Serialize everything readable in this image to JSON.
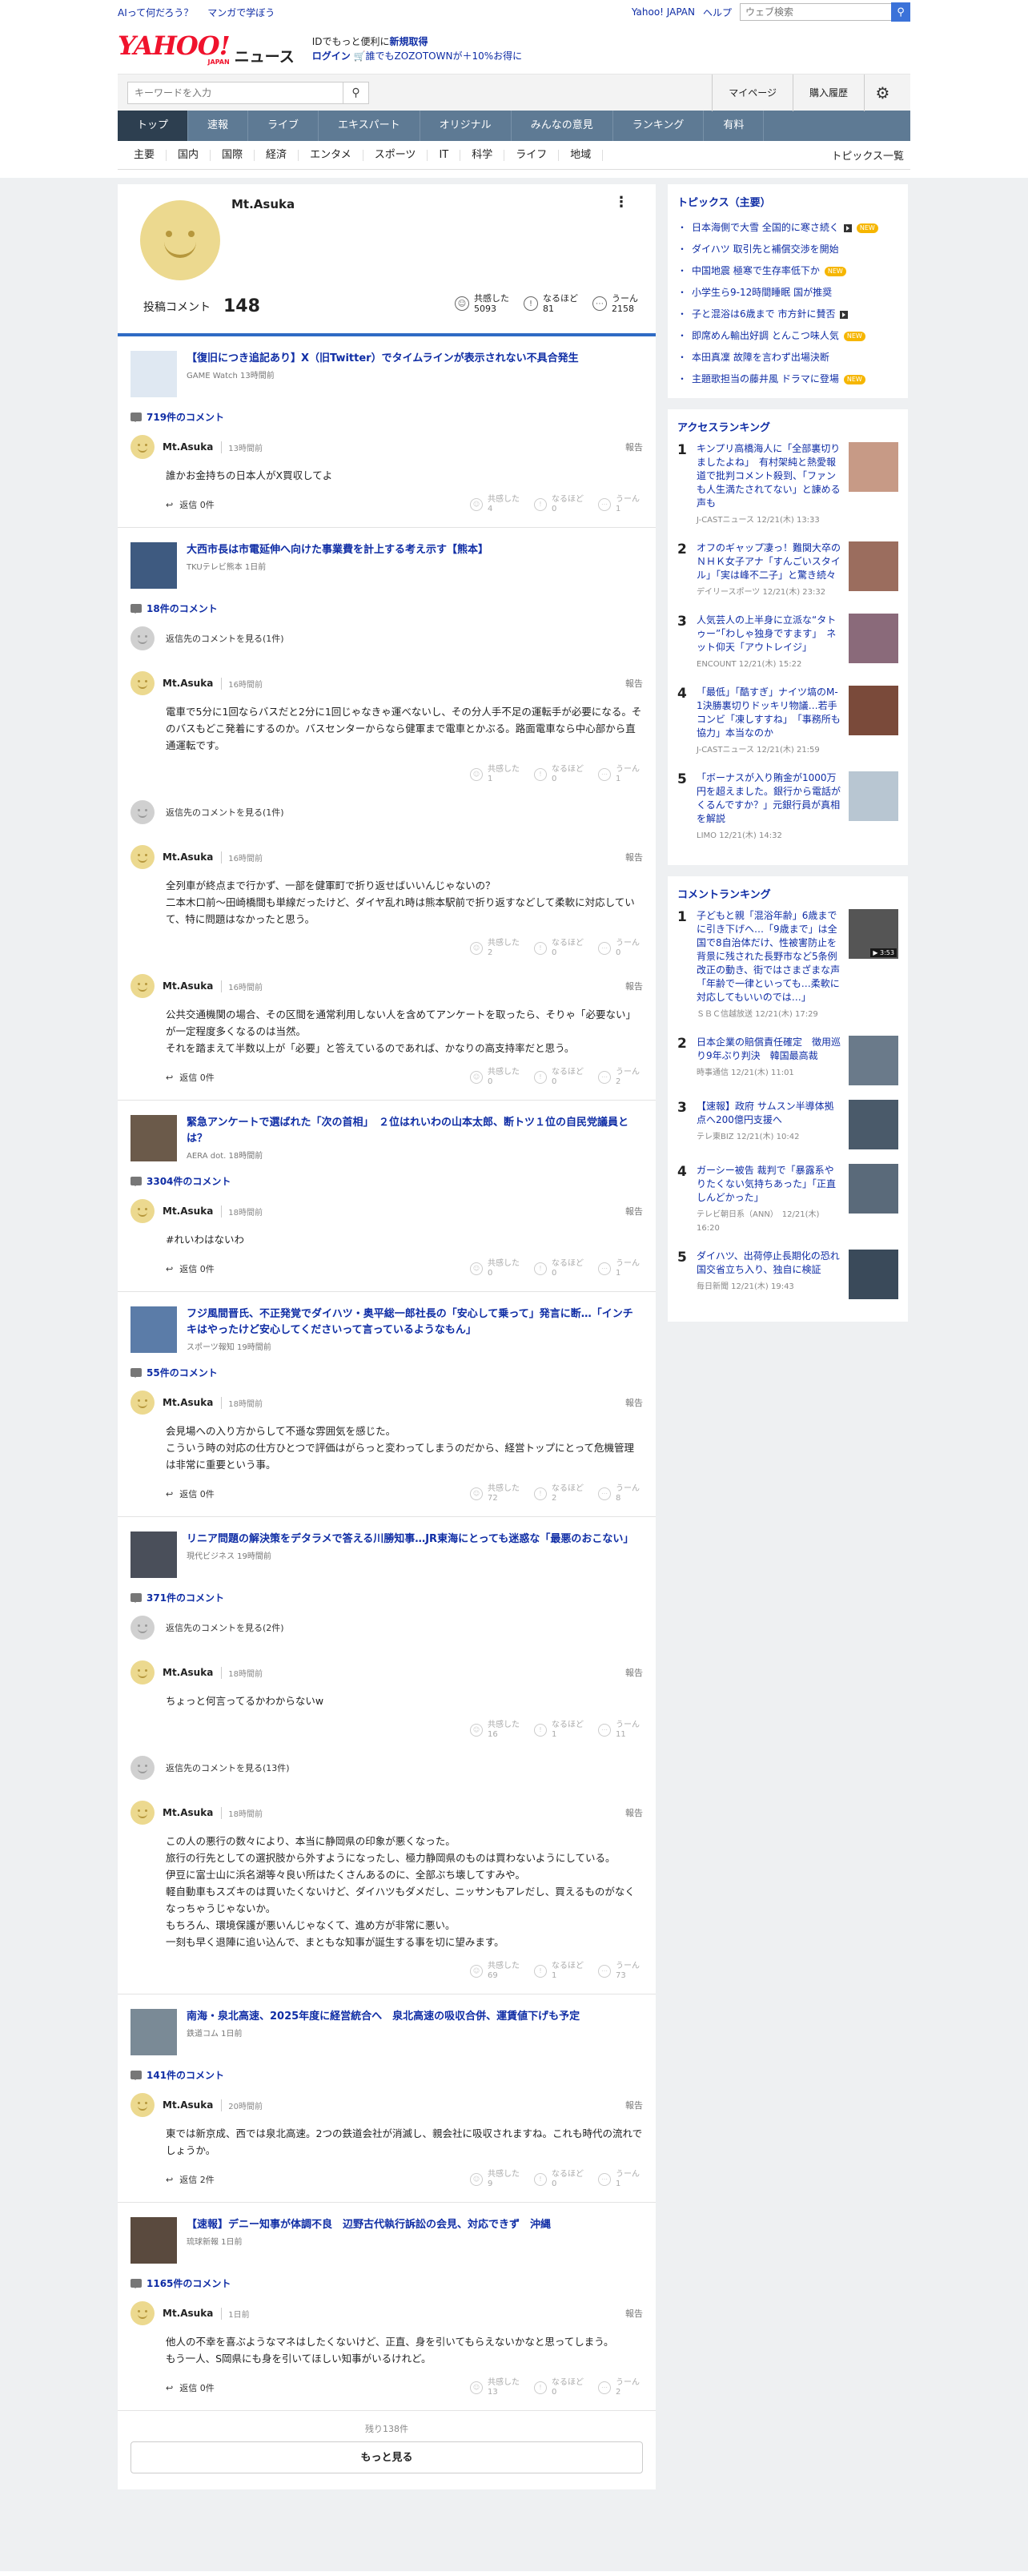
{
  "util": {
    "left": [
      "AIって何だろう？",
      "マンガで学ぼう"
    ],
    "right": [
      "Yahoo! JAPAN",
      "ヘルプ"
    ],
    "search_placeholder": "ウェブ検索"
  },
  "header": {
    "logo": "YAHOO!",
    "logo_sub": "JAPAN",
    "section": "ニュース",
    "promo1_a": "IDでもっと便利に",
    "promo1_b": "新規取得",
    "promo2_a": "ログイン",
    "promo2_b": "誰でもZOZOTOWNが＋10%お得に"
  },
  "search": {
    "placeholder": "キーワードを入力",
    "links": [
      "マイページ",
      "購入履歴"
    ]
  },
  "nav": [
    "トップ",
    "速報",
    "ライブ",
    "エキスパート",
    "オリジナル",
    "みんなの意見",
    "ランキング",
    "有料"
  ],
  "subnav": [
    "主要",
    "国内",
    "国際",
    "経済",
    "エンタメ",
    "スポーツ",
    "IT",
    "科学",
    "ライフ",
    "地域"
  ],
  "subnav_right": "トピックス一覧",
  "profile": {
    "name": "Mt.Asuka",
    "posted_label": "投稿コメント",
    "posted_count": "148",
    "reactions": [
      {
        "label": "共感した",
        "value": "5093",
        "icon": "smile-icon"
      },
      {
        "label": "なるほど",
        "value": "81",
        "icon": "bulb-icon"
      },
      {
        "label": "うーん",
        "value": "2158",
        "icon": "hmm-icon"
      }
    ]
  },
  "labels": {
    "report": "報告",
    "reply_prefix": "返信",
    "r1": "共感した",
    "r2": "なるほど",
    "r3": "うーん"
  },
  "articles": [
    {
      "title": "【復旧につき追記あり】X（旧Twitter）でタイムラインが表示されない不具合発生",
      "source": "GAME Watch 13時間前",
      "thumb": "#dfe8f2",
      "count": "719件のコメント",
      "comments": [
        {
          "pre": null,
          "author": "Mt.Asuka",
          "time": "13時間前",
          "text": "誰かお金持ちの日本人がX買収してよ",
          "replies": "返信 0件",
          "r": [
            "4",
            "0",
            "1"
          ]
        }
      ]
    },
    {
      "title": "大西市長は市電延伸へ向けた事業費を計上する考え示す【熊本】",
      "source": "TKUテレビ熊本 1日前",
      "thumb": "#3e5a80",
      "count": "18件のコメント",
      "comments": [
        {
          "pre": "返信先のコメントを見る(1件)",
          "author": "Mt.Asuka",
          "time": "16時間前",
          "text": "電車で5分に1回ならバスだと2分に1回じゃなきゃ運べないし、その分人手不足の運転手が必要になる。そのバスもどこ発着にするのか。バスセンターからなら健軍まで電車とかぶる。路面電車なら中心部から直通運転です。",
          "replies": null,
          "r": [
            "1",
            "0",
            "1"
          ]
        },
        {
          "pre": "返信先のコメントを見る(1件)",
          "author": "Mt.Asuka",
          "time": "16時間前",
          "text": "全列車が終点まで行かず、一部を健軍町で折り返せばいいんじゃないの？\n二本木口前〜田崎橋間も単線だったけど、ダイヤ乱れ時は熊本駅前で折り返すなどして柔軟に対応していて、特に問題はなかったと思う。",
          "replies": null,
          "r": [
            "2",
            "0",
            "0"
          ]
        },
        {
          "pre": null,
          "author": "Mt.Asuka",
          "time": "16時間前",
          "text": "公共交通機関の場合、その区間を通常利用しない人を含めてアンケートを取ったら、そりゃ「必要ない」が一定程度多くなるのは当然。\nそれを踏まえて半数以上が「必要」と答えているのであれば、かなりの高支持率だと思う。",
          "replies": "返信 0件",
          "r": [
            "0",
            "0",
            "2"
          ]
        }
      ]
    },
    {
      "title": "緊急アンケートで選ばれた「次の首相」　２位はれいわの山本太郎、断トツ１位の自民党議員とは？",
      "source": "AERA dot. 18時間前",
      "thumb": "#6b5a4a",
      "count": "3304件のコメント",
      "comments": [
        {
          "pre": null,
          "author": "Mt.Asuka",
          "time": "18時間前",
          "text": "#れいわはないわ",
          "replies": "返信 0件",
          "r": [
            "0",
            "0",
            "1"
          ]
        }
      ]
    },
    {
      "title": "フジ風間晋氏、不正発覚でダイハツ・奥平総一郎社長の「安心して乗って」発言に断…「インチキはやったけど安心してくださいって言っているようなもん」",
      "source": "スポーツ報知 19時間前",
      "thumb": "#5b7ca8",
      "count": "55件のコメント",
      "comments": [
        {
          "pre": null,
          "author": "Mt.Asuka",
          "time": "18時間前",
          "text": "会見場への入り方からして不遜な雰囲気を感じた。\nこういう時の対応の仕方ひとつで評価はがらっと変わってしまうのだから、経営トップにとって危機管理は非常に重要という事。",
          "replies": "返信 0件",
          "r": [
            "72",
            "2",
            "8"
          ]
        }
      ]
    },
    {
      "title": "リニア問題の解決策をデタラメで答える川勝知事…JR東海にとっても迷惑な「最悪のおこない」",
      "source": "現代ビジネス 19時間前",
      "thumb": "#4a4f5a",
      "count": "371件のコメント",
      "comments": [
        {
          "pre": "返信先のコメントを見る(2件)",
          "author": "Mt.Asuka",
          "time": "18時間前",
          "text": "ちょっと何言ってるかわからないw",
          "replies": null,
          "r": [
            "16",
            "1",
            "11"
          ]
        },
        {
          "pre": "返信先のコメントを見る(13件)",
          "author": "Mt.Asuka",
          "time": "18時間前",
          "text": "この人の悪行の数々により、本当に静岡県の印象が悪くなった。\n旅行の行先としての選択肢から外すようになったし、極力静岡県のものは買わないようにしている。\n伊豆に富士山に浜名湖等々良い所はたくさんあるのに、全部ぶち壊してすみや。\n軽自動車もスズキのは買いたくないけど、ダイハツもダメだし、ニッサンもアレだし、買えるものがなくなっちゃうじゃないか。\nもちろん、環境保護が悪いんじゃなくて、進め方が非常に悪い。\n一刻も早く退陣に追い込んで、まともな知事が誕生する事を切に望みます。",
          "replies": null,
          "r": [
            "69",
            "1",
            "73"
          ]
        }
      ]
    },
    {
      "title": "南海・泉北高速、2025年度に経営統合へ　泉北高速の吸収合併、運賃値下げも予定",
      "source": "鉄道コム 1日前",
      "thumb": "#7a8a96",
      "count": "141件のコメント",
      "comments": [
        {
          "pre": null,
          "author": "Mt.Asuka",
          "time": "20時間前",
          "text": "東では新京成、西では泉北高速。2つの鉄道会社が消滅し、親会社に吸収されますね。これも時代の流れでしょうか。",
          "replies": "返信 2件",
          "r": [
            "9",
            "0",
            "1"
          ]
        }
      ]
    },
    {
      "title": "【速報】デニー知事が体調不良　辺野古代執行訴訟の会見、対応できず　沖縄",
      "source": "琉球新報 1日前",
      "thumb": "#5a4a3e",
      "count": "1165件のコメント",
      "comments": [
        {
          "pre": null,
          "author": "Mt.Asuka",
          "time": "1日前",
          "text": "他人の不幸を喜ぶようなマネはしたくないけど、正直、身を引いてもらえないかなと思ってしまう。\nもう一人、S岡県にも身を引いてほしい知事がいるけれど。",
          "replies": "返信 0件",
          "r": [
            "13",
            "0",
            "2"
          ]
        }
      ]
    }
  ],
  "more": {
    "rest": "残り138件",
    "button": "もっと見る"
  },
  "side": {
    "topics_title": "トピックス（主要）",
    "topics": [
      {
        "t": "日本海側で大雪 全国的に寒さ続く",
        "video": true,
        "new": true
      },
      {
        "t": "ダイハツ 取引先と補償交渉を開始",
        "video": false,
        "new": false
      },
      {
        "t": "中国地震 極寒で生存率低下か",
        "video": false,
        "new": true
      },
      {
        "t": "小学生ら9-12時間睡眠 国が推奨",
        "video": false,
        "new": false
      },
      {
        "t": "子と混浴は6歳まで 市方針に賛否",
        "video": true,
        "new": false
      },
      {
        "t": "即席めん輸出好調 とんこつ味人気",
        "video": false,
        "new": true
      },
      {
        "t": "本田真凜 故障を言わず出場決断",
        "video": false,
        "new": false
      },
      {
        "t": "主題歌担当の藤井風 ドラマに登場",
        "video": false,
        "new": true
      }
    ],
    "new_label": "NEW",
    "access_title": "アクセスランキング",
    "access": [
      {
        "n": "1",
        "t": "キンプリ高橋海人に「全部裏切りましたよね」　有村架純と熱愛報道で批判コメント殺到、「ファンも人生満たされてない」と諌める声も",
        "s": "J-CASTニュース 12/21(木) 13:33",
        "img": "#c79a86"
      },
      {
        "n": "2",
        "t": "オフのギャップ凄っ！難関大卒のＮＨＫ女子アナ「すんごいスタイル」「実は峰不二子」と驚き続々",
        "s": "デイリースポーツ 12/21(木) 23:32",
        "img": "#9b6d5e"
      },
      {
        "n": "3",
        "t": "人気芸人の上半身に立派な“タトゥー”「わしゃ独身ですます」　ネット仰天「アウトレイジ」",
        "s": "ENCOUNT 12/21(木) 15:22",
        "img": "#8a6a7a"
      },
      {
        "n": "4",
        "t": "「最低」「酷すぎ」ナイツ塙のM-1決勝裏切りドッキリ物議…若手コンビ「凍しすすね」　「事務所も協力」本当なのか",
        "s": "J-CASTニュース 12/21(木) 21:59",
        "img": "#7a4a3a"
      },
      {
        "n": "5",
        "t": "「ボーナスが入り賄金が1000万円を超えました。銀行から電話がくるんですか？」元銀行員が真相を解説",
        "s": "LIMO 12/21(木) 14:32",
        "img": "#b8c6d2"
      }
    ],
    "comment_title": "コメントランキング",
    "comment": [
      {
        "n": "1",
        "t": "子どもと親「混浴年齢」6歳までに引き下げへ…「9歳まで」は全国で8自治体だけ、性被害防止を背景に残された長野市など5条例改正の動き、街ではさまざまな声「年齢で一律といっても…柔軟に対応してもいいのでは…」",
        "s": "ＳＢＣ信越放送 12/21(木) 17:29",
        "img": "#555",
        "dur": "▶ 3:53"
      },
      {
        "n": "2",
        "t": "日本企業の賠償責任確定　徴用巡り9年ぶり判決　韓国最高裁",
        "s": "時事通信 12/21(木) 11:01",
        "img": "#6a7a8a",
        "dur": ""
      },
      {
        "n": "3",
        "t": "【速報】政府 サムスン半導体拠点へ200億円支援へ",
        "s": "テレ東BIZ 12/21(木) 10:42",
        "img": "#4a5a6a",
        "dur": ""
      },
      {
        "n": "4",
        "t": "ガーシー被告 裁判で「暴露系やりたくない気持ちあった」「正直しんどかった」",
        "s": "テレビ朝日系（ANN）　12/21(木) 16:20",
        "img": "#5a6a7a",
        "dur": ""
      },
      {
        "n": "5",
        "t": "ダイハツ、出荷停止長期化の恐れ　国交省立ち入り、独自に検証",
        "s": "毎日新聞 12/21(木) 19:43",
        "img": "#3a4a5a",
        "dur": ""
      }
    ]
  }
}
